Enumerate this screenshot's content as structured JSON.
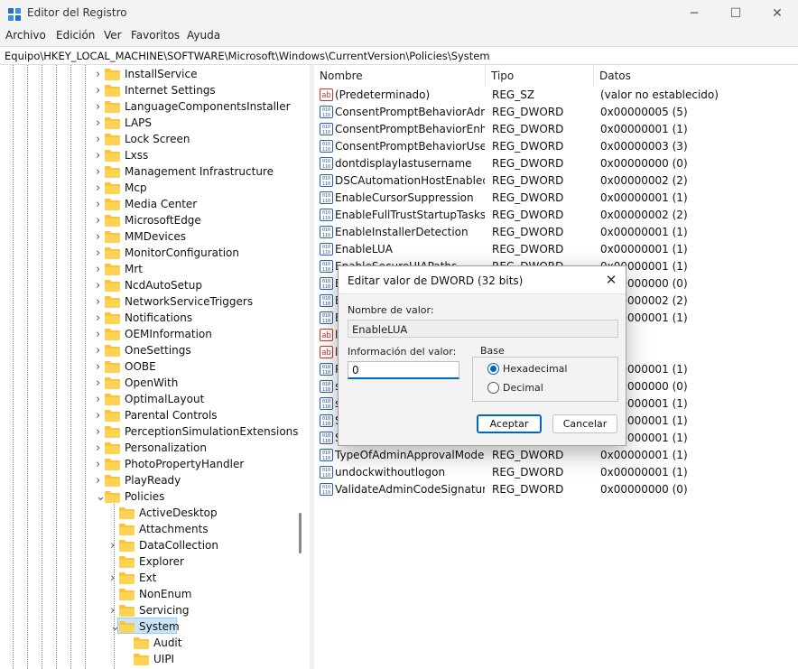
{
  "window": {
    "title": "Editor del Registro"
  },
  "menu": [
    "Archivo",
    "Edición",
    "Ver",
    "Favoritos",
    "Ayuda"
  ],
  "address": "Equipo\\HKEY_LOCAL_MACHINE\\SOFTWARE\\Microsoft\\Windows\\CurrentVersion\\Policies\\System",
  "tree": {
    "items": [
      {
        "label": "InstallService"
      },
      {
        "label": "Internet Settings"
      },
      {
        "label": "LanguageComponentsInstaller"
      },
      {
        "label": "LAPS"
      },
      {
        "label": "Lock Screen"
      },
      {
        "label": "Lxss"
      },
      {
        "label": "Management Infrastructure"
      },
      {
        "label": "Mcp"
      },
      {
        "label": "Media Center"
      },
      {
        "label": "MicrosoftEdge"
      },
      {
        "label": "MMDevices"
      },
      {
        "label": "MonitorConfiguration"
      },
      {
        "label": "Mrt"
      },
      {
        "label": "NcdAutoSetup"
      },
      {
        "label": "NetworkServiceTriggers"
      },
      {
        "label": "Notifications"
      },
      {
        "label": "OEMInformation"
      },
      {
        "label": "OneSettings"
      },
      {
        "label": "OOBE"
      },
      {
        "label": "OpenWith"
      },
      {
        "label": "OptimalLayout"
      },
      {
        "label": "Parental Controls"
      },
      {
        "label": "PerceptionSimulationExtensions"
      },
      {
        "label": "Personalization"
      },
      {
        "label": "PhotoPropertyHandler"
      },
      {
        "label": "PlayReady"
      },
      {
        "label": "Policies"
      },
      {
        "label": "ActiveDesktop"
      },
      {
        "label": "Attachments"
      },
      {
        "label": "DataCollection"
      },
      {
        "label": "Explorer"
      },
      {
        "label": "Ext"
      },
      {
        "label": "NonEnum"
      },
      {
        "label": "Servicing"
      },
      {
        "label": "System"
      },
      {
        "label": "Audit"
      },
      {
        "label": "UIPI"
      }
    ]
  },
  "list": {
    "headers": {
      "name": "Nombre",
      "type": "Tipo",
      "data": "Datos"
    },
    "rows": [
      {
        "name": "(Predeterminado)",
        "type": "REG_SZ",
        "data": "(valor no establecido)",
        "icon": "string-value-icon"
      },
      {
        "name": "ConsentPromptBehaviorAdmin",
        "type": "REG_DWORD",
        "data": "0x00000005 (5)",
        "icon": "binary-value-icon"
      },
      {
        "name": "ConsentPromptBehaviorEnha...",
        "type": "REG_DWORD",
        "data": "0x00000001 (1)",
        "icon": "binary-value-icon"
      },
      {
        "name": "ConsentPromptBehaviorUser",
        "type": "REG_DWORD",
        "data": "0x00000003 (3)",
        "icon": "binary-value-icon"
      },
      {
        "name": "dontdisplaylastusername",
        "type": "REG_DWORD",
        "data": "0x00000000 (0)",
        "icon": "binary-value-icon"
      },
      {
        "name": "DSCAutomationHostEnabled",
        "type": "REG_DWORD",
        "data": "0x00000002 (2)",
        "icon": "binary-value-icon"
      },
      {
        "name": "EnableCursorSuppression",
        "type": "REG_DWORD",
        "data": "0x00000001 (1)",
        "icon": "binary-value-icon"
      },
      {
        "name": "EnableFullTrustStartupTasks",
        "type": "REG_DWORD",
        "data": "0x00000002 (2)",
        "icon": "binary-value-icon"
      },
      {
        "name": "EnableInstallerDetection",
        "type": "REG_DWORD",
        "data": "0x00000001 (1)",
        "icon": "binary-value-icon"
      },
      {
        "name": "EnableLUA",
        "type": "REG_DWORD",
        "data": "0x00000001 (1)",
        "icon": "binary-value-icon"
      },
      {
        "name": "EnableSecureUIAPaths",
        "type": "REG_DWORD",
        "data": "0x00000001 (1)",
        "icon": "binary-value-icon"
      },
      {
        "name": "E",
        "type": "",
        "data": "0x00000000 (0)",
        "icon": "binary-value-icon"
      },
      {
        "name": "E",
        "type": "",
        "data": "0x00000002 (2)",
        "icon": "binary-value-icon"
      },
      {
        "name": "E",
        "type": "",
        "data": "0x00000001 (1)",
        "icon": "binary-value-icon"
      },
      {
        "name": "le",
        "type": "",
        "data": "",
        "icon": "string-value-icon"
      },
      {
        "name": "le",
        "type": "",
        "data": "",
        "icon": "string-value-icon"
      },
      {
        "name": "P",
        "type": "",
        "data": "0x00000001 (1)",
        "icon": "binary-value-icon"
      },
      {
        "name": "s",
        "type": "",
        "data": "0x00000000 (0)",
        "icon": "binary-value-icon"
      },
      {
        "name": "s",
        "type": "",
        "data": "0x00000001 (1)",
        "icon": "binary-value-icon"
      },
      {
        "name": "S",
        "type": "",
        "data": "0x00000001 (1)",
        "icon": "binary-value-icon"
      },
      {
        "name": "S",
        "type": "",
        "data": "0x00000001 (1)",
        "icon": "binary-value-icon"
      },
      {
        "name": "TypeOfAdminApprovalMode",
        "type": "REG_DWORD",
        "data": "0x00000001 (1)",
        "icon": "binary-value-icon"
      },
      {
        "name": "undockwithoutlogon",
        "type": "REG_DWORD",
        "data": "0x00000001 (1)",
        "icon": "binary-value-icon"
      },
      {
        "name": "ValidateAdminCodeSignatures",
        "type": "REG_DWORD",
        "data": "0x00000000 (0)",
        "icon": "binary-value-icon"
      }
    ]
  },
  "dialog": {
    "title": "Editar valor de DWORD (32 bits)",
    "name_label": "Nombre de valor:",
    "name_value": "EnableLUA",
    "data_label": "Información del valor:",
    "data_value": "0",
    "base_label": "Base",
    "hex_label": "Hexadecimal",
    "dec_label": "Decimal",
    "ok_label": "Aceptar",
    "cancel_label": "Cancelar"
  },
  "colors": {
    "accent": "#0067c0",
    "folder": "#f8c43c",
    "selection": "#cce4f7"
  }
}
